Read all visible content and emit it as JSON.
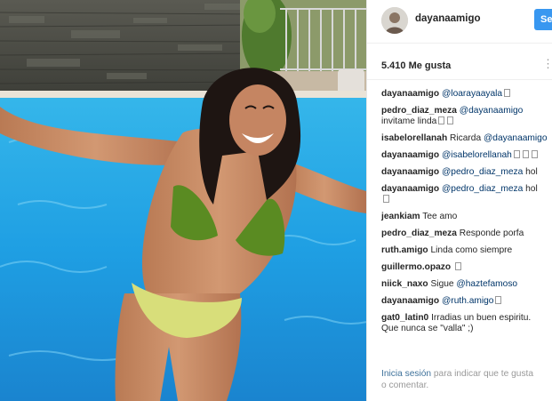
{
  "photo": {
    "description_icon": "photo-icon"
  },
  "header": {
    "username": "dayanaamigo",
    "follow_label": "Seguir"
  },
  "stats": {
    "likes_text": "5.410 Me gusta",
    "more_icon": "ellipsis-icon"
  },
  "comments": [
    {
      "user": "dayanaamigo",
      "text": "@loarayaayala",
      "mention": true,
      "squares": 1
    },
    {
      "user": "pedro_diaz_meza",
      "text": "@dayanaamigo",
      "mention": true,
      "extra": "invitame linda",
      "squares": 2
    },
    {
      "user": "isabelorellanah",
      "pre": "Ricarda ",
      "text": "@dayanaamigo",
      "mention": true,
      "squares": 0
    },
    {
      "user": "dayanaamigo",
      "text": "@isabelorellanah",
      "mention": true,
      "squares": 3
    },
    {
      "user": "dayanaamigo",
      "text": "@pedro_diaz_meza",
      "mention": true,
      "post": " hol",
      "squares": 0
    },
    {
      "user": "dayanaamigo",
      "text": "@pedro_diaz_meza",
      "mention": true,
      "post": " hol",
      "squares": 1,
      "square_newline": true
    },
    {
      "user": "jeankiam",
      "text": "Tee amo",
      "mention": false,
      "squares": 0
    },
    {
      "user": "pedro_diaz_meza",
      "text": "Responde porfa",
      "mention": false,
      "squares": 0
    },
    {
      "user": "ruth.amigo",
      "text": "Linda como siempre",
      "mention": false,
      "squares": 0
    },
    {
      "user": "guillermo.opazo",
      "text": "",
      "mention": false,
      "squares": 1
    },
    {
      "user": "niick_naxo",
      "pre": "Sigue ",
      "text": "@haztefamoso",
      "mention": true,
      "squares": 0
    },
    {
      "user": "dayanaamigo",
      "text": "@ruth.amigo",
      "mention": true,
      "squares": 1
    },
    {
      "user": "gat0_latin0",
      "text": "Irradias un buen espiritu.",
      "mention": false,
      "extra": "Que nunca se \"valla\" ;)",
      "squares": 0
    }
  ],
  "footer": {
    "login_link": "Inicia sesión",
    "login_rest": " para indicar que te gusta",
    "line2": "o comentar."
  },
  "colors": {
    "follow_blue": "#3897f0",
    "mention_blue": "#003569",
    "link_blue": "#3f729b",
    "pool_blue": "#2a8fd6"
  }
}
